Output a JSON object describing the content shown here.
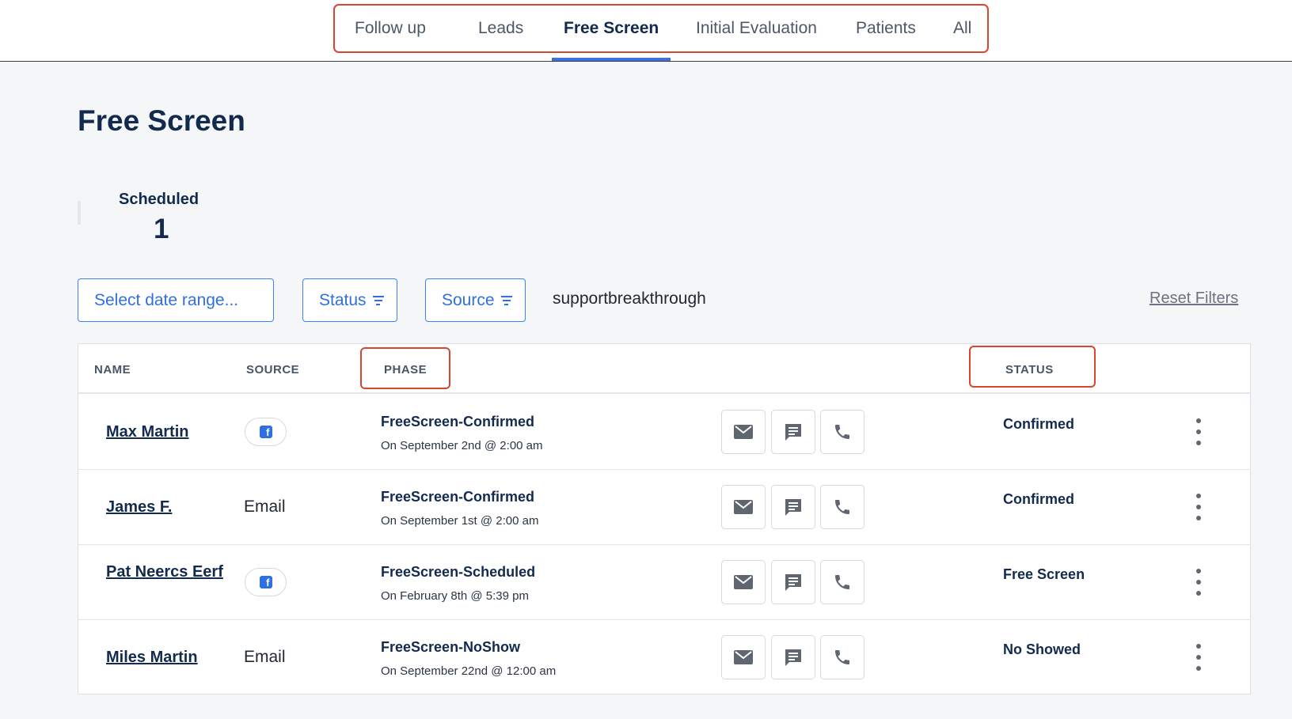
{
  "nav": {
    "tabs": [
      {
        "label": "Follow up",
        "active": false
      },
      {
        "label": "Leads",
        "active": false
      },
      {
        "label": "Free Screen",
        "active": true
      },
      {
        "label": "Initial Evaluation",
        "active": false
      },
      {
        "label": "Patients",
        "active": false
      },
      {
        "label": "All",
        "active": false
      }
    ]
  },
  "page": {
    "title": "Free Screen",
    "stat": {
      "label": "Scheduled",
      "value": "1"
    }
  },
  "filters": {
    "date_range": "Select date range...",
    "status": "Status",
    "source": "Source",
    "organization": "supportbreakthrough",
    "reset": "Reset Filters"
  },
  "table": {
    "headers": {
      "name": "NAME",
      "source": "SOURCE",
      "phase": "PHASE",
      "status": "STATUS"
    },
    "rows": [
      {
        "name": "Max Martin",
        "source": "facebook-icon",
        "source_label": "",
        "phase": "FreeScreen-Confirmed",
        "phase_date": "On September 2nd @ 2:00 am",
        "status": "Confirmed"
      },
      {
        "name": "James F.",
        "source": "text",
        "source_label": "Email",
        "phase": "FreeScreen-Confirmed",
        "phase_date": "On September 1st @ 2:00 am",
        "status": "Confirmed"
      },
      {
        "name": "Pat Neercs Eerf",
        "source": "facebook-icon",
        "source_label": "",
        "phase": "FreeScreen-Scheduled",
        "phase_date": "On February 8th @ 5:39 pm",
        "status": "Free Screen"
      },
      {
        "name": "Miles Martin",
        "source": "text",
        "source_label": "Email",
        "phase": "FreeScreen-NoShow",
        "phase_date": "On September 22nd @ 12:00 am",
        "status": "No Showed"
      }
    ],
    "row_actions": [
      "mail-icon",
      "message-icon",
      "phone-icon"
    ],
    "row_menu_icon": "more-vertical-icon"
  },
  "colors": {
    "primary": "#132a4f",
    "accent": "#3f6fe8",
    "highlight": "#d9452e",
    "background": "#f5f6f8"
  }
}
